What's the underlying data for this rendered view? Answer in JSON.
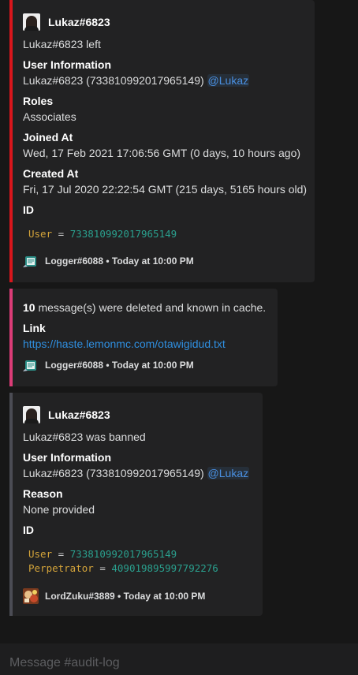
{
  "embeds": [
    {
      "author": "Lukaz#6823",
      "description": "Lukaz#6823 left",
      "fields": {
        "user_info_name": "User Information",
        "user_info_value_prefix": "Lukaz#6823 (733810992017965149) ",
        "user_info_mention": "@Lukaz",
        "roles_name": "Roles",
        "roles_value": "Associates",
        "joined_name": "Joined At",
        "joined_value": "Wed, 17 Feb 2021 17:06:56 GMT (0 days, 10 hours ago)",
        "created_name": "Created At",
        "created_value": "Fri, 17 Jul 2020 22:22:54 GMT (215 days, 5165 hours old)",
        "id_name": "ID"
      },
      "code": {
        "key": "User",
        "eq": " = ",
        "value": "733810992017965149"
      },
      "footer": "Logger#6088 • Today at 10:00 PM",
      "color": "#d8161c"
    },
    {
      "desc_count": "10",
      "desc_text": " message(s) were deleted and known in cache.",
      "link_name": "Link",
      "link_value": "https://haste.lemonmc.com/otawigidud.txt",
      "footer": "Logger#6088 • Today at 10:00 PM",
      "color": "#db3c77"
    },
    {
      "author": "Lukaz#6823",
      "description": "Lukaz#6823 was banned",
      "fields": {
        "user_info_name": "User Information",
        "user_info_value_prefix": "Lukaz#6823 (733810992017965149) ",
        "user_info_mention": "@Lukaz",
        "reason_name": "Reason",
        "reason_value": "None provided",
        "id_name": "ID"
      },
      "code": {
        "key1": "User",
        "eq1": " = ",
        "value1": "733810992017965149",
        "key2": "Perpetrator",
        "eq2": " = ",
        "value2": "409019895997792276"
      },
      "footer": "LordZuku#3889 • Today at 10:00 PM",
      "color": "#4b4c54"
    }
  ],
  "message_input": {
    "placeholder": "Message #audit-log"
  },
  "icons": [
    "avatar-icon",
    "logger-bot-icon",
    "lordzuku-avatar-icon"
  ]
}
